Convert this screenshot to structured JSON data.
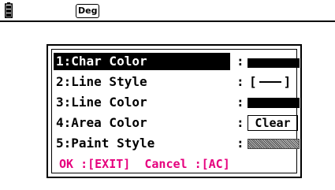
{
  "status_bar": {
    "battery_icon": "battery-icon",
    "angle_mode": "Deg"
  },
  "dialog": {
    "items": [
      {
        "label": "1:Char Color",
        "separator": ":",
        "value_type": "swatch",
        "swatch_color": "#000000"
      },
      {
        "label": "2:Line Style",
        "separator": ":",
        "value_type": "line-style",
        "open_bracket": "[",
        "close_bracket": "]"
      },
      {
        "label": "3:Line Color",
        "separator": ":",
        "value_type": "swatch",
        "swatch_color": "#000000"
      },
      {
        "label": "4:Area Color",
        "separator": ":",
        "value_type": "text",
        "value": "Clear"
      },
      {
        "label": "5:Paint Style",
        "separator": ":",
        "value_type": "pattern"
      }
    ],
    "selected_index": 0,
    "footer": {
      "ok_text": "OK :[EXIT]",
      "cancel_text": "Cancel :[AC]",
      "color": "#e6007e"
    }
  }
}
